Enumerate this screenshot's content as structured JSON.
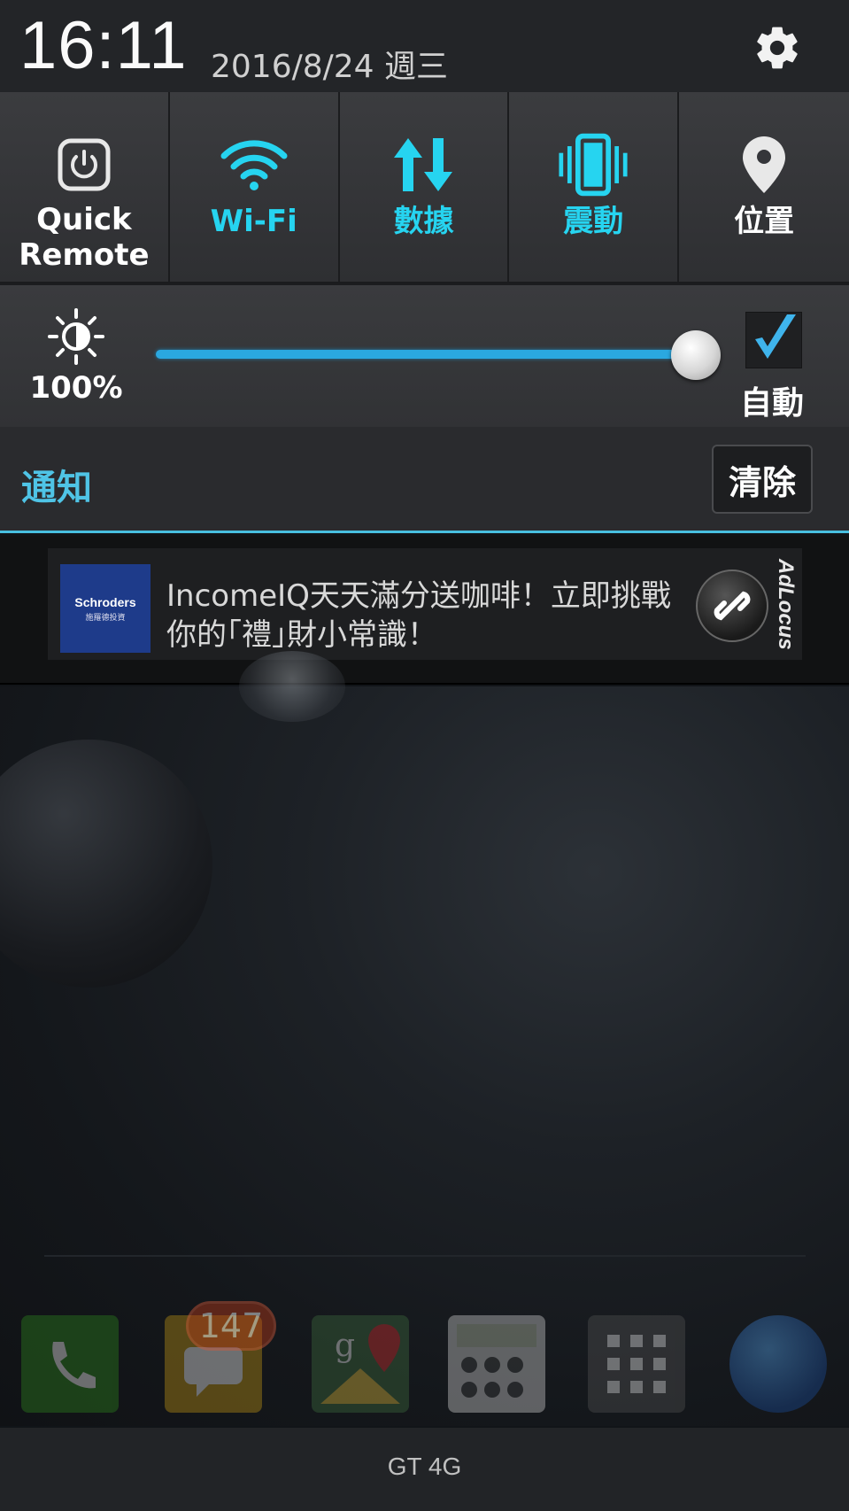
{
  "status": {
    "time": "16:11",
    "date": "2016/8/24 週三",
    "settings_icon": "gear-icon"
  },
  "quick_settings": [
    {
      "label": "Quick\nRemote",
      "icon": "power-remote-icon",
      "active": false
    },
    {
      "label": "Wi-Fi",
      "icon": "wifi-icon",
      "active": true
    },
    {
      "label": "數據",
      "icon": "data-arrows-icon",
      "active": true
    },
    {
      "label": "震動",
      "icon": "vibrate-icon",
      "active": true
    },
    {
      "label": "位置",
      "icon": "location-icon",
      "active": false
    }
  ],
  "brightness": {
    "value_label": "100%",
    "level": 1.0,
    "auto_label": "自動",
    "auto_checked": true
  },
  "notifications": {
    "title": "通知",
    "clear_label": "清除",
    "items": [
      {
        "logo_brand": "Schroders",
        "logo_sub": "施羅德投資",
        "line1": "IncomeIQ天天滿分送咖啡！立即挑戰",
        "line2": "你的｢禮｣財小常識！",
        "ad_brand": "AdLocus"
      }
    ]
  },
  "dock": {
    "badge_count": "147",
    "apps": [
      "phone-icon",
      "messages-icon",
      "maps-icon",
      "calculator-icon",
      "apps-grid-icon",
      "browser-globe-icon"
    ]
  },
  "carrier": "GT 4G",
  "colors": {
    "accent": "#26d4f0",
    "notif_title": "#4fc4e6",
    "slider": "#2aa8e0"
  }
}
